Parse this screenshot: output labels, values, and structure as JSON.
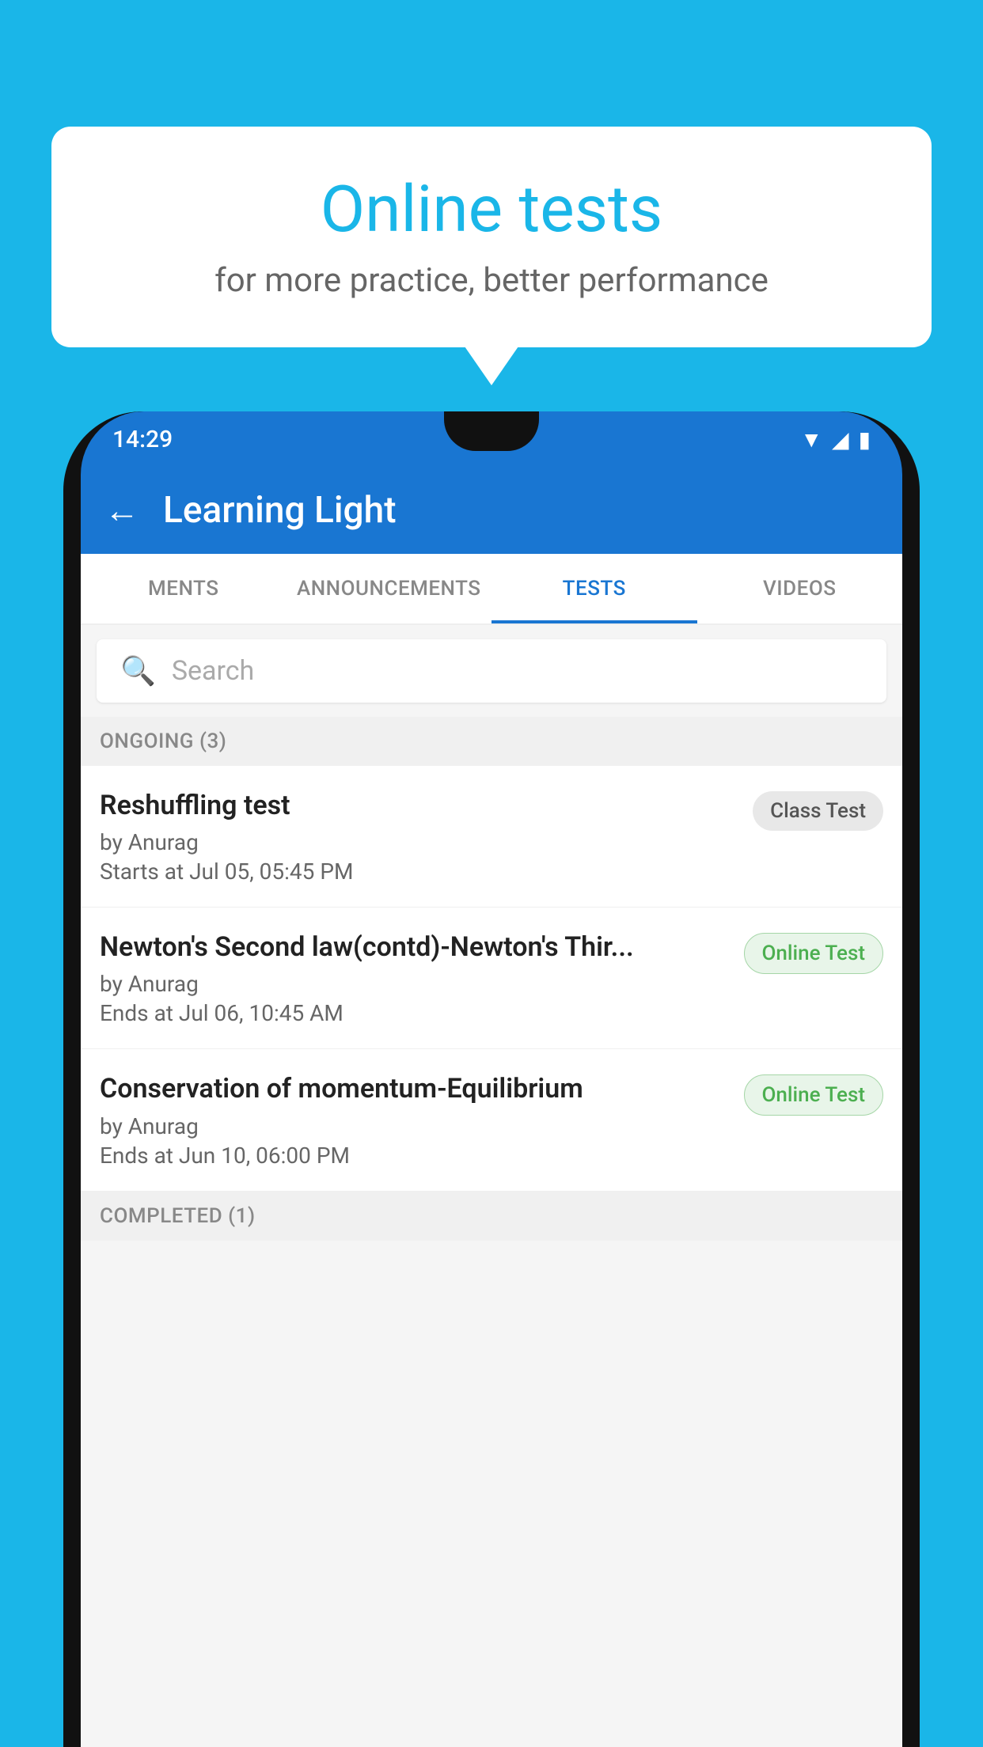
{
  "background_color": "#1ab6e8",
  "speech_bubble": {
    "title": "Online tests",
    "subtitle": "for more practice, better performance"
  },
  "phone": {
    "status_bar": {
      "time": "14:29",
      "icons": [
        "wifi",
        "signal",
        "battery"
      ]
    },
    "app_bar": {
      "title": "Learning Light",
      "back_label": "←"
    },
    "tabs": [
      {
        "label": "MENTS",
        "active": false
      },
      {
        "label": "ANNOUNCEMENTS",
        "active": false
      },
      {
        "label": "TESTS",
        "active": true
      },
      {
        "label": "VIDEOS",
        "active": false
      }
    ],
    "search": {
      "placeholder": "Search"
    },
    "ongoing_section": {
      "label": "ONGOING (3)",
      "tests": [
        {
          "name": "Reshuffling test",
          "author": "by Anurag",
          "time_label": "Starts at",
          "time": "Jul 05, 05:45 PM",
          "badge": "Class Test",
          "badge_type": "class"
        },
        {
          "name": "Newton's Second law(contd)-Newton's Thir...",
          "author": "by Anurag",
          "time_label": "Ends at",
          "time": "Jul 06, 10:45 AM",
          "badge": "Online Test",
          "badge_type": "online"
        },
        {
          "name": "Conservation of momentum-Equilibrium",
          "author": "by Anurag",
          "time_label": "Ends at",
          "time": "Jun 10, 06:00 PM",
          "badge": "Online Test",
          "badge_type": "online"
        }
      ]
    },
    "completed_section": {
      "label": "COMPLETED (1)"
    }
  }
}
